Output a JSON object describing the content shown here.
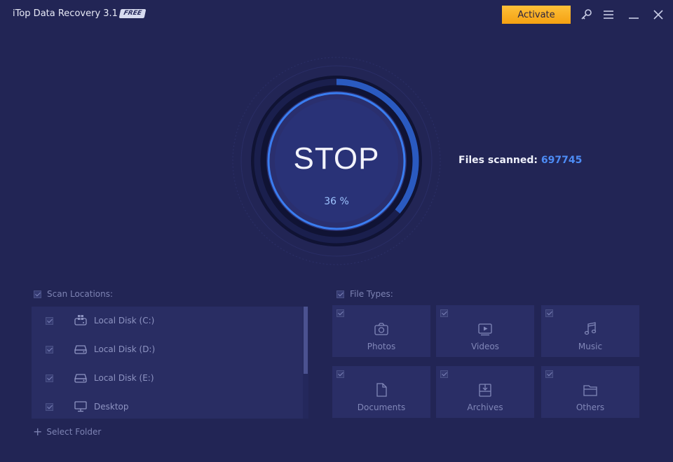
{
  "window": {
    "title": "iTop Data Recovery 3.1",
    "badge": "FREE",
    "activate_label": "Activate",
    "icons": [
      "key-icon",
      "menu-icon",
      "minimize-icon",
      "close-icon"
    ]
  },
  "scan": {
    "stop_label": "STOP",
    "percent_label": "36 %",
    "progress": 0.36,
    "files_scanned_label": "Files scanned:",
    "files_scanned_count": "697745"
  },
  "scan_locations": {
    "heading": "Scan Locations:",
    "items": [
      {
        "label": "Local Disk (C:)",
        "icon": "windows-drive-icon",
        "checked": true
      },
      {
        "label": "Local Disk (D:)",
        "icon": "drive-icon",
        "checked": true
      },
      {
        "label": "Local Disk (E:)",
        "icon": "drive-icon",
        "checked": true
      },
      {
        "label": "Desktop",
        "icon": "monitor-icon",
        "checked": true
      }
    ],
    "select_folder_label": "Select Folder"
  },
  "file_types": {
    "heading": "File Types:",
    "items": [
      {
        "label": "Photos",
        "icon": "camera-icon",
        "checked": true
      },
      {
        "label": "Videos",
        "icon": "video-icon",
        "checked": true
      },
      {
        "label": "Music",
        "icon": "music-note-icon",
        "checked": true
      },
      {
        "label": "Documents",
        "icon": "document-icon",
        "checked": true
      },
      {
        "label": "Archives",
        "icon": "archive-icon",
        "checked": true
      },
      {
        "label": "Others",
        "icon": "folder-icon",
        "checked": true
      }
    ]
  },
  "colors": {
    "background": "#222555",
    "accent_blue": "#4d8cf5",
    "activate_orange": "#f7a91f",
    "panel": "#292d63"
  }
}
